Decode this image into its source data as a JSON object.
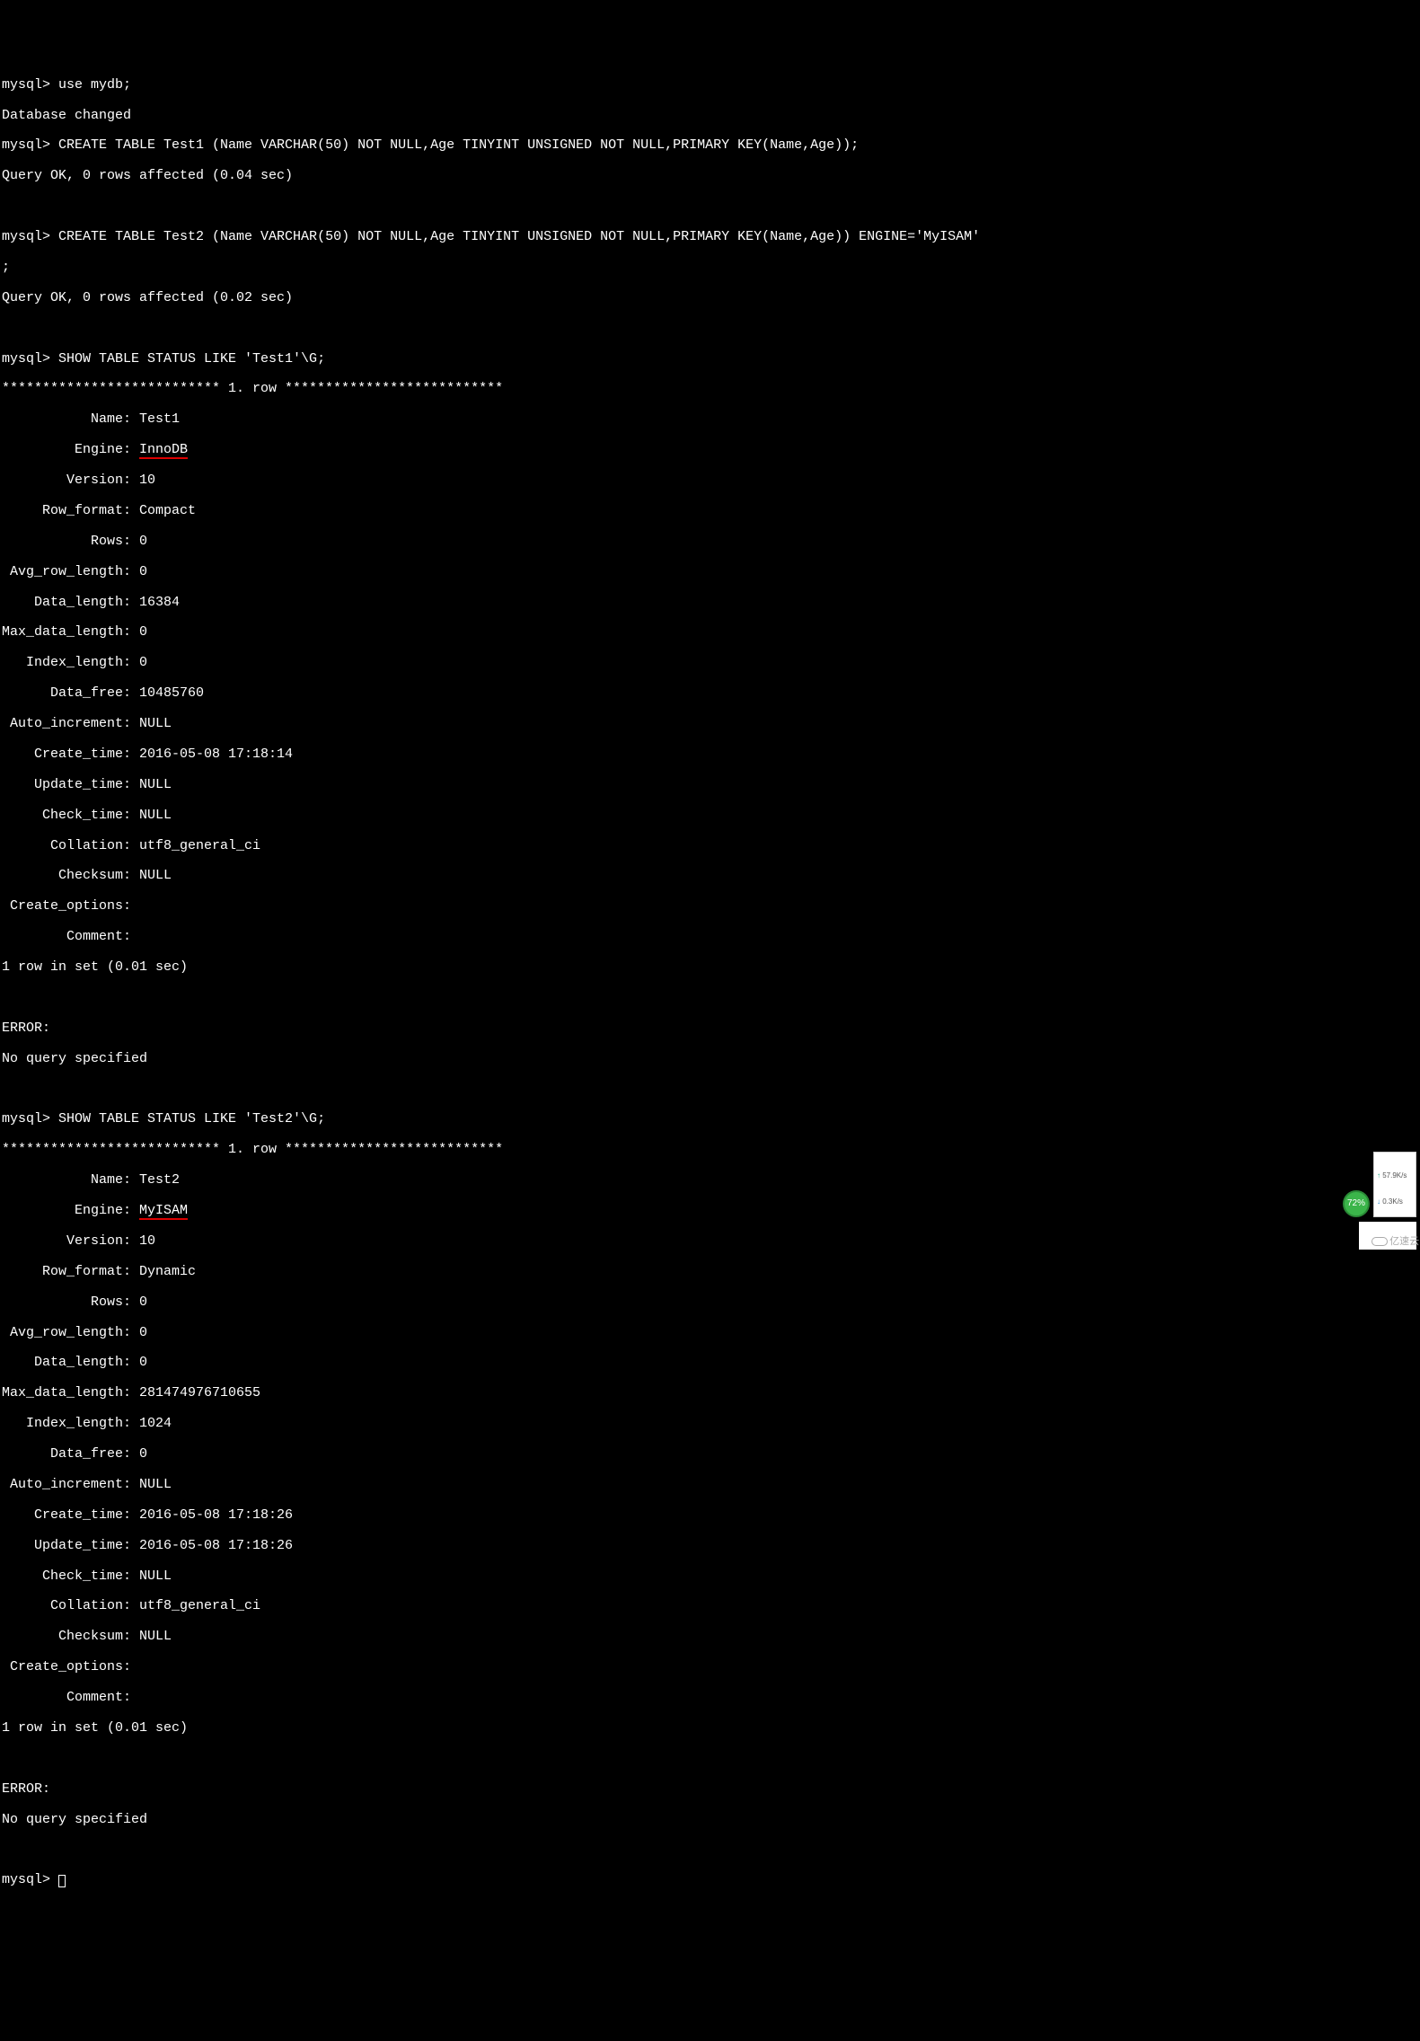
{
  "prompt": "mysql> ",
  "lines": {
    "cmd1": "use mydb;",
    "resp1": "Database changed",
    "cmd2": "CREATE TABLE Test1 (Name VARCHAR(50) NOT NULL,Age TINYINT UNSIGNED NOT NULL,PRIMARY KEY(Name,Age));",
    "resp2": "Query OK, 0 rows affected (0.04 sec)",
    "cmd3": "CREATE TABLE Test2 (Name VARCHAR(50) NOT NULL,Age TINYINT UNSIGNED NOT NULL,PRIMARY KEY(Name,Age)) ENGINE='MyISAM'",
    "semicolon": ";",
    "resp3": "Query OK, 0 rows affected (0.02 sec)",
    "cmd4": "SHOW TABLE STATUS LIKE 'Test1'\\G;",
    "rowhdr": "*************************** 1. row ***************************",
    "cmd5": "SHOW TABLE STATUS LIKE 'Test2'\\G;",
    "rows_in_set": "1 row in set (0.01 sec)",
    "error": "ERROR:",
    "noquery": "No query specified"
  },
  "test1": {
    "Name": "Test1",
    "Engine": "InnoDB",
    "Version": "10",
    "Row_format": "Compact",
    "Rows": "0",
    "Avg_row_length": "0",
    "Data_length": "16384",
    "Max_data_length": "0",
    "Index_length": "0",
    "Data_free": "10485760",
    "Auto_increment": "NULL",
    "Create_time": "2016-05-08 17:18:14",
    "Update_time": "NULL",
    "Check_time": "NULL",
    "Collation": "utf8_general_ci",
    "Checksum": "NULL",
    "Create_options": "",
    "Comment": ""
  },
  "test2": {
    "Name": "Test2",
    "Engine": "MyISAM",
    "Version": "10",
    "Row_format": "Dynamic",
    "Rows": "0",
    "Avg_row_length": "0",
    "Data_length": "0",
    "Max_data_length": "281474976710655",
    "Index_length": "1024",
    "Data_free": "0",
    "Auto_increment": "NULL",
    "Create_time": "2016-05-08 17:18:26",
    "Update_time": "2016-05-08 17:18:26",
    "Check_time": "NULL",
    "Collation": "utf8_general_ci",
    "Checksum": "NULL",
    "Create_options": "",
    "Comment": ""
  },
  "labels": {
    "Name": "           Name: ",
    "Engine": "         Engine: ",
    "Version": "        Version: ",
    "Row_format": "     Row_format: ",
    "Rows": "           Rows: ",
    "Avg_row_length": " Avg_row_length: ",
    "Data_length": "    Data_length: ",
    "Max_data_length": "Max_data_length: ",
    "Index_length": "   Index_length: ",
    "Data_free": "      Data_free: ",
    "Auto_increment": " Auto_increment: ",
    "Create_time": "    Create_time: ",
    "Update_time": "    Update_time: ",
    "Check_time": "     Check_time: ",
    "Collation": "      Collation: ",
    "Checksum": "       Checksum: ",
    "Create_options": " Create_options:",
    "Comment": "        Comment:"
  },
  "badge": "72%",
  "netstat": {
    "up": "57.9K/s",
    "down": "0.3K/s"
  },
  "watermark": "亿速云"
}
